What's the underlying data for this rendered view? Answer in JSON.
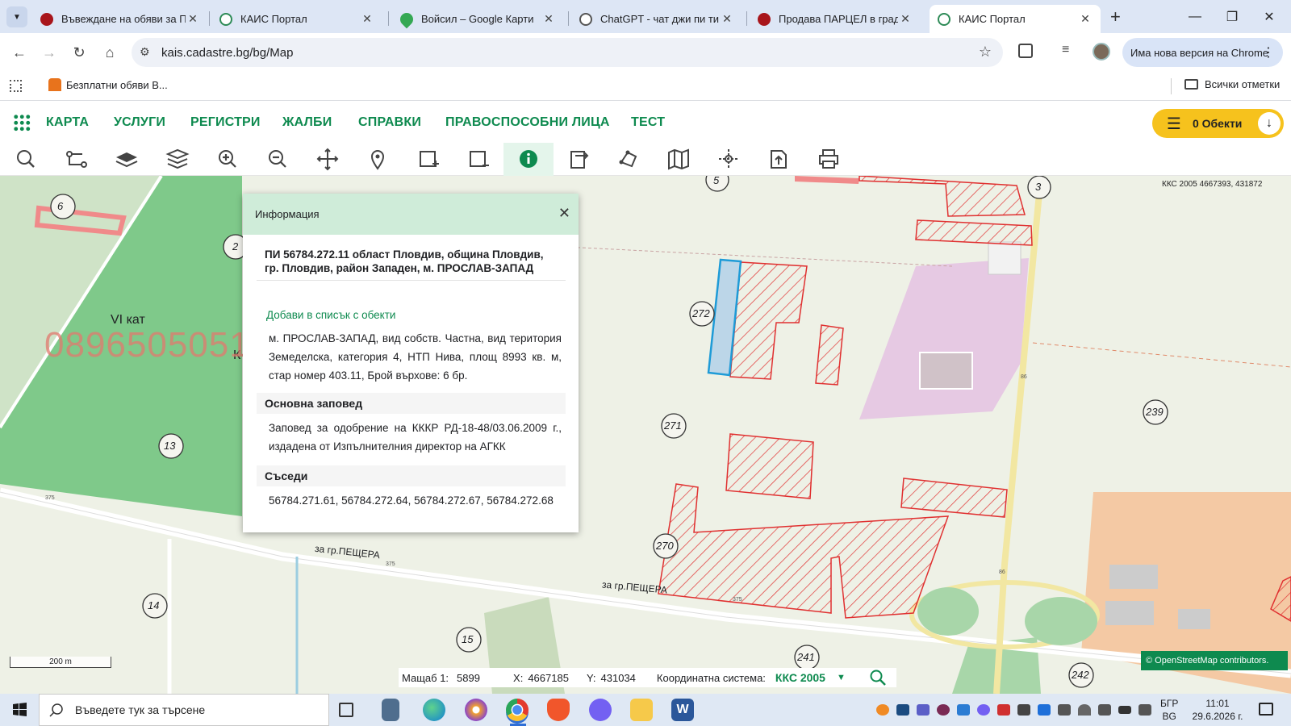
{
  "browser": {
    "tabs": [
      {
        "title": "Въвеждане на обяви за П",
        "favicon_color": "#a8151b",
        "active": false
      },
      {
        "title": "КАИС Портал",
        "favicon_color": "#2e8b57",
        "active": false
      },
      {
        "title": "Войсил – Google Карти",
        "favicon_color": "#34a853",
        "active": false
      },
      {
        "title": "ChatGPT - чат джи пи ти",
        "favicon_color": "#555555",
        "active": false
      },
      {
        "title": "Продава ПАРЦЕЛ в град",
        "favicon_color": "#a8151b",
        "active": false
      },
      {
        "title": "КАИС Портал",
        "favicon_color": "#2e8b57",
        "active": true
      }
    ],
    "url": "kais.cadastre.bg/bg/Map",
    "update_label": "Има нова версия на Chrome",
    "bookmark": "Безплатни обяви В...",
    "all_bookmarks": "Всички отметки"
  },
  "app_nav": {
    "items": [
      "КАРТА",
      "УСЛУГИ",
      "РЕГИСТРИ",
      "ЖАЛБИ",
      "СПРАВКИ",
      "ПРАВОСПОСОБНИ ЛИЦА",
      "ТЕСТ"
    ],
    "objects_label": "0 Обекти"
  },
  "map_tools": [
    "search",
    "measure",
    "layers-flat",
    "layers",
    "zoom-in",
    "zoom-out",
    "pan",
    "pin",
    "select-rect",
    "deselect-rect",
    "info",
    "export",
    "polygon",
    "map",
    "coordinates",
    "upload",
    "print"
  ],
  "map": {
    "coord_readout": "ККС 2005 4667393, 431872",
    "labels": {
      "l6": "6",
      "l2": "2",
      "l13": "13",
      "l14": "14",
      "l15": "15",
      "l5": "5",
      "l3": "3",
      "l272": "272",
      "l271": "271",
      "l270": "270",
      "l239": "239",
      "l241": "241",
      "l242": "242"
    },
    "category": "VI кат",
    "category_b": "К",
    "watermark": "0896505051",
    "road_name_1": "за гр.ПЕЩЕРА",
    "road_name_2": "за гр.ПЕЩЕРА",
    "road_num_a": "375",
    "road_num_b": "375",
    "road_num_c": "375",
    "road_num_d": "86",
    "road_num_e": "86",
    "scale_bar": "200 m",
    "osm": "© OpenStreetMap contributors."
  },
  "info_popup": {
    "header": "Информация",
    "title": "ПИ 56784.272.11 област Пловдив, община Пловдив, гр. Пловдив, район Западен, м. ПРОСЛАВ-ЗАПАД",
    "add_link": "Добави в списък с обекти",
    "details": "м. ПРОСЛАВ-ЗАПАД, вид собств. Частна, вид територия Земеделска, категория 4, НТП Нива, площ 8993 кв. м, стар номер 403.11, Брой върхове: 6 бр.",
    "order_title": "Основна заповед",
    "order_text": "Заповед за одобрение на КККР РД-18-48/03.06.2009 г., издадена от Изпълнителния директор на АГКК",
    "neighbours_title": "Съседи",
    "neighbours_text": "56784.271.61, 56784.272.64, 56784.272.67, 56784.272.68"
  },
  "status": {
    "scale_label": "Мащаб 1:",
    "scale_value": "5899",
    "x_label": "X:",
    "x_value": "4667185",
    "y_label": "Y:",
    "y_value": "431034",
    "crs_label": "Координатна система:",
    "crs_value": "ККС 2005"
  },
  "taskbar": {
    "search_placeholder": "Въведете тук за търсене",
    "lang_top": "БГР",
    "lang_bottom": "BG",
    "time": "11:01",
    "date": "29.6.2026 г."
  },
  "colors": {
    "accent": "#0e8a4f",
    "objects_button": "#f6c21d",
    "parcel_hatch": "#e03030",
    "selected_parcel": "#1e9bd7"
  }
}
